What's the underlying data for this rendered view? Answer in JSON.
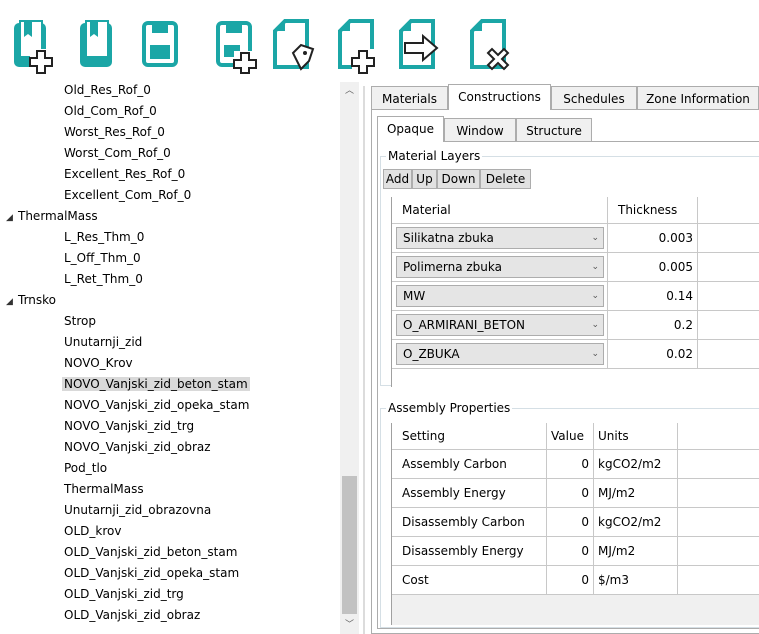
{
  "toolbar": {
    "buttons": [
      {
        "name": "new-library-button",
        "icon": "book-plus-icon"
      },
      {
        "name": "open-library-button",
        "icon": "book-icon"
      },
      {
        "name": "save-button",
        "icon": "floppy-disk-icon"
      },
      {
        "name": "save-as-button",
        "icon": "floppy-disk-plus-icon"
      },
      {
        "name": "tag-document-button",
        "icon": "document-tag-icon"
      },
      {
        "name": "new-document-button",
        "icon": "document-plus-icon"
      },
      {
        "name": "export-document-button",
        "icon": "document-arrow-icon"
      },
      {
        "name": "delete-document-button",
        "icon": "document-x-icon"
      }
    ],
    "accent_color": "#1ba6a6"
  },
  "tree": {
    "items": [
      {
        "label": "Old_Res_Rof_0",
        "level": 2
      },
      {
        "label": "Old_Com_Rof_0",
        "level": 2
      },
      {
        "label": "Worst_Res_Rof_0",
        "level": 2
      },
      {
        "label": "Worst_Com_Rof_0",
        "level": 2
      },
      {
        "label": "Excellent_Res_Rof_0",
        "level": 2
      },
      {
        "label": "Excellent_Com_Rof_0",
        "level": 2
      },
      {
        "label": "ThermalMass",
        "level": 1,
        "expanded": true
      },
      {
        "label": "L_Res_Thm_0",
        "level": 2
      },
      {
        "label": "L_Off_Thm_0",
        "level": 2
      },
      {
        "label": "L_Ret_Thm_0",
        "level": 2
      },
      {
        "label": "Trnsko",
        "level": 1,
        "expanded": true
      },
      {
        "label": "Strop",
        "level": 2
      },
      {
        "label": "Unutarnji_zid",
        "level": 2
      },
      {
        "label": "NOVO_Krov",
        "level": 2
      },
      {
        "label": "NOVO_Vanjski_zid_beton_stam",
        "level": 2,
        "selected": true
      },
      {
        "label": "NOVO_Vanjski_zid_opeka_stam",
        "level": 2
      },
      {
        "label": "NOVO_Vanjski_zid_trg",
        "level": 2
      },
      {
        "label": "NOVO_Vanjski_zid_obraz",
        "level": 2
      },
      {
        "label": "Pod_tlo",
        "level": 2
      },
      {
        "label": "ThermalMass",
        "level": 2
      },
      {
        "label": "Unutarnji_zid_obrazovna",
        "level": 2
      },
      {
        "label": "OLD_krov",
        "level": 2
      },
      {
        "label": "OLD_Vanjski_zid_beton_stam",
        "level": 2
      },
      {
        "label": "OLD_Vanjski_zid_opeka_stam",
        "level": 2
      },
      {
        "label": "OLD_Vanjski_zid_trg",
        "level": 2
      },
      {
        "label": "OLD_Vanjski_zid_obraz",
        "level": 2
      }
    ],
    "expand_glyph": "◢"
  },
  "tabs": {
    "main": [
      "Materials",
      "Constructions",
      "Schedules",
      "Zone Information"
    ],
    "main_active": "Constructions",
    "sub": [
      "Opaque",
      "Window",
      "Structure"
    ],
    "sub_active": "Opaque"
  },
  "material_layers": {
    "title": "Material Layers",
    "buttons": [
      "Add",
      "Up",
      "Down",
      "Delete"
    ],
    "columns": [
      "Material",
      "Thickness"
    ],
    "rows": [
      {
        "material": "Silikatna zbuka",
        "thickness": "0.003"
      },
      {
        "material": "Polimerna zbuka",
        "thickness": "0.005"
      },
      {
        "material": "MW",
        "thickness": "0.14"
      },
      {
        "material": "O_ARMIRANI_BETON",
        "thickness": "0.2"
      },
      {
        "material": "O_ZBUKA",
        "thickness": "0.02"
      }
    ]
  },
  "assembly_properties": {
    "title": "Assembly Properties",
    "columns": [
      "Setting",
      "Value",
      "Units"
    ],
    "rows": [
      {
        "setting": "Assembly Carbon",
        "value": "0",
        "units": "kgCO2/m2"
      },
      {
        "setting": "Assembly Energy",
        "value": "0",
        "units": "MJ/m2"
      },
      {
        "setting": "Disassembly Carbon",
        "value": "0",
        "units": "kgCO2/m2"
      },
      {
        "setting": "Disassembly Energy",
        "value": "0",
        "units": "MJ/m2"
      },
      {
        "setting": "Cost",
        "value": "0",
        "units": "$/m3"
      }
    ]
  },
  "scrollbar": {
    "up_glyph": "︿",
    "down_glyph": "﹀"
  },
  "combo_arrow_glyph": "⌄"
}
